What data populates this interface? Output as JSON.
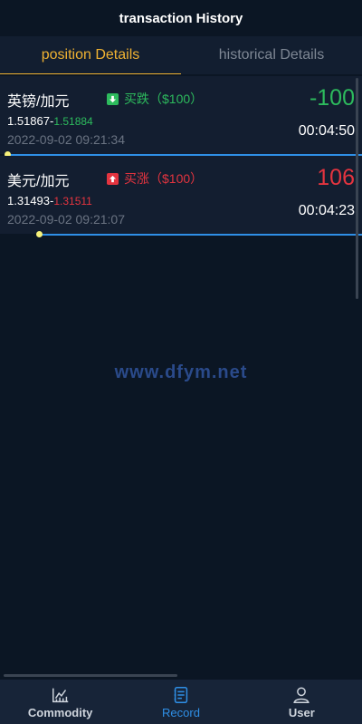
{
  "header": {
    "title": "transaction History"
  },
  "tabs": [
    {
      "label": "position Details",
      "active": true
    },
    {
      "label": "historical Details",
      "active": false
    }
  ],
  "positions": [
    {
      "pair": "英镑/加元",
      "direction": "down",
      "direction_label": "买跌（$100）",
      "open_price": "1.51867",
      "current_price": "1.51884",
      "time": "2022-09-02 09:21:34",
      "profit": "-100",
      "profit_color": "green",
      "countdown": "00:04:50",
      "progress": 1.0
    },
    {
      "pair": "美元/加元",
      "direction": "up",
      "direction_label": "买涨（$100）",
      "open_price": "1.31493",
      "current_price": "1.31511",
      "time": "2022-09-02 09:21:07",
      "profit": "106",
      "profit_color": "red",
      "countdown": "00:04:23",
      "progress": 0.91
    }
  ],
  "watermark": "www.dfym.net",
  "bottom_nav": [
    {
      "label": "Commodity",
      "icon": "chart-icon",
      "active": false
    },
    {
      "label": "Record",
      "icon": "record-icon",
      "active": true
    },
    {
      "label": "User",
      "icon": "user-icon",
      "active": false
    }
  ],
  "colors": {
    "accent": "#f0b232",
    "green": "#2dbb5d",
    "red": "#e4343f",
    "blue": "#2f8fe6"
  }
}
